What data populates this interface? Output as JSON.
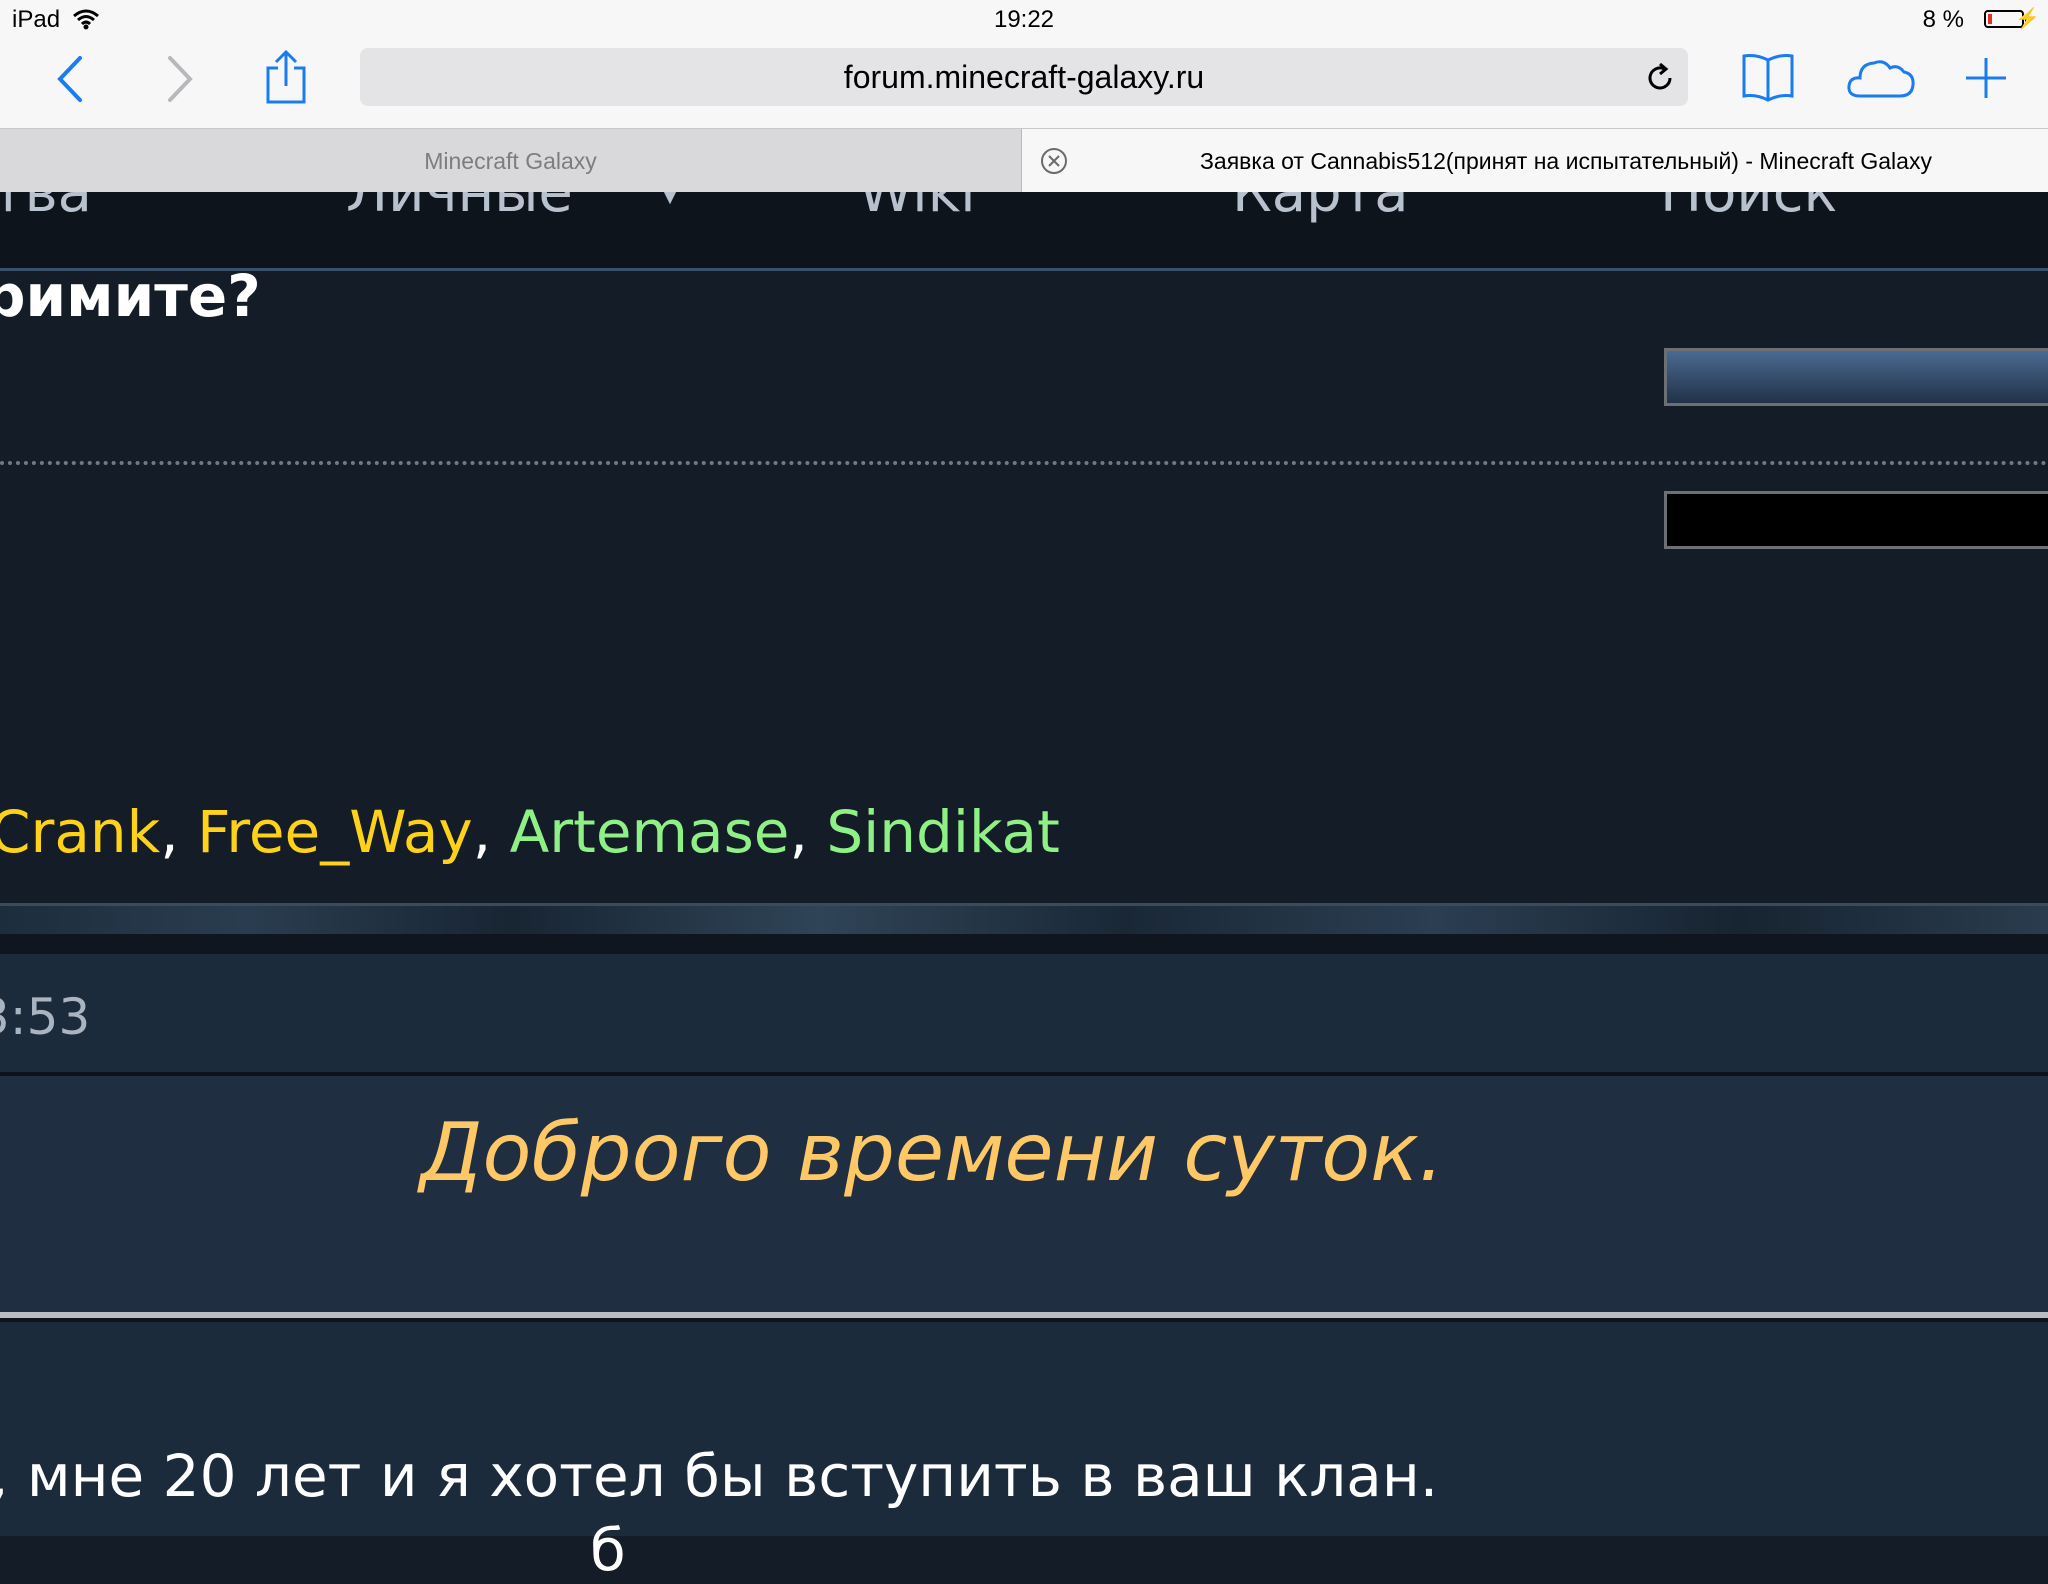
{
  "status_bar": {
    "device": "iPad",
    "time": "19:22",
    "battery": "8 %"
  },
  "browser": {
    "url": "forum.minecraft-galaxy.ru",
    "tabs": [
      {
        "title": "Minecraft Galaxy",
        "active": false
      },
      {
        "title": "Заявка от Cannabis512(принят на испытательный) - Minecraft Galaxy",
        "active": true
      }
    ],
    "accent_color": "#1a7cf0"
  },
  "page": {
    "nav": [
      "тва",
      "Личные",
      "Wiki",
      "Карта",
      "Поиск"
    ],
    "question": "римите?",
    "online_users": [
      {
        "name": "Crank",
        "color": "#ffd21a"
      },
      {
        "name": "Free_Way",
        "color": "#ffd21a"
      },
      {
        "name": "Artemase",
        "color": "#8ff086"
      },
      {
        "name": "Sindikat",
        "color": "#8ff086"
      }
    ],
    "separator": ",",
    "post": {
      "time": "3:53",
      "greeting": "Доброго времени суток.",
      "body": ", мне 20 лет и я хотел бы вступить в ваш клан.",
      "body_partial": "б"
    }
  }
}
